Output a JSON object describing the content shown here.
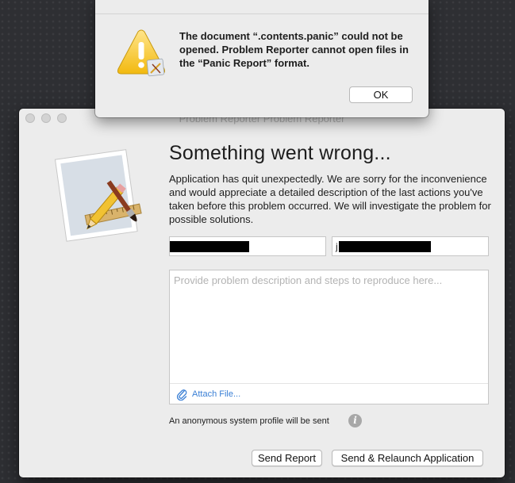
{
  "window": {
    "title": "Problem Reporter Problem Reporter"
  },
  "main": {
    "headline": "Something went wrong...",
    "description": "Application has quit unexpectedly. We are sorry for the inconvenience and would appreciate a detailed description of the last actions you've taken before this problem occurred. We will investigate the problem for possible solutions.",
    "field_1_value": "",
    "field_2_visible_prefix": "j",
    "problem_placeholder": "Provide problem description and steps to reproduce here...",
    "attach_label": "Attach File...",
    "profile_note": "An anonymous system profile will be sent",
    "info_glyph": "i",
    "send_report_label": "Send Report",
    "send_relaunch_label": "Send & Relaunch Application"
  },
  "alert": {
    "message": "The document “.contents.panic” could not be opened. Problem Reporter cannot open files in the “Panic Report” format.",
    "ok_label": "OK"
  },
  "icons": {
    "app": "app-icon-pencil-ruler-brush",
    "caution": "warning-triangle-icon",
    "attach": "paperclip-icon",
    "info": "info-icon"
  },
  "colors": {
    "link": "#3a7fd5",
    "window_bg": "#ececec",
    "desktop_bg": "#2e2f33"
  }
}
